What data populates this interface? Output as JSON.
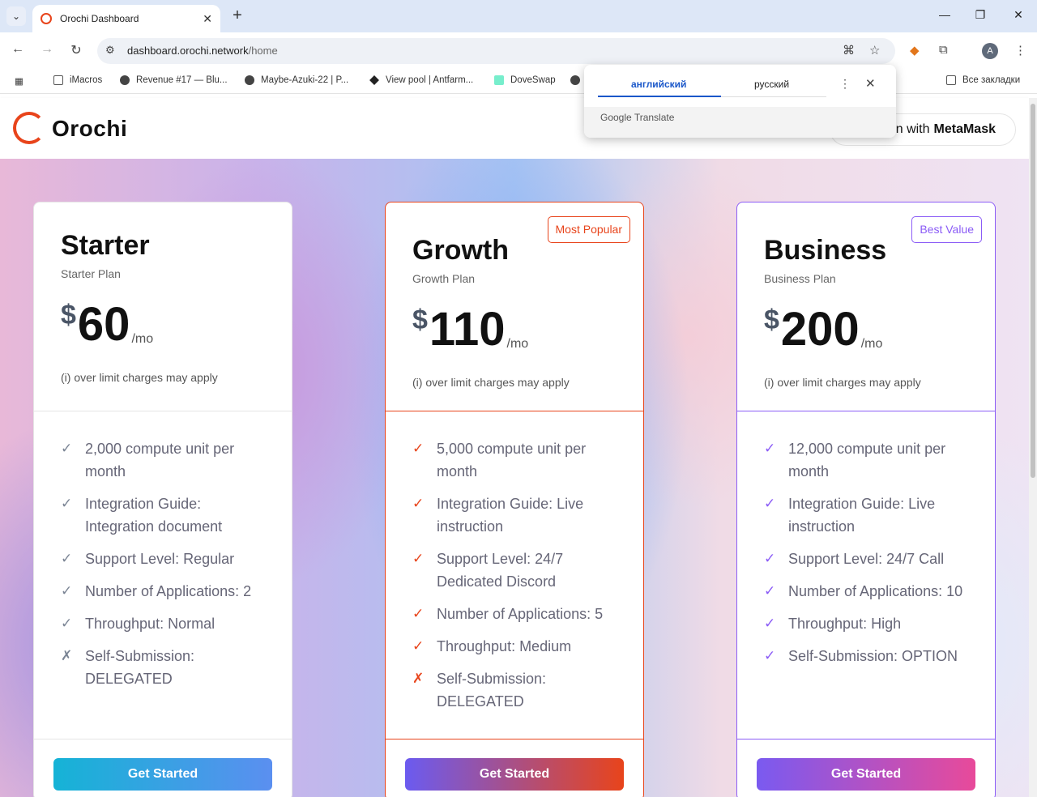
{
  "browser": {
    "tab_title": "Orochi Dashboard",
    "url_host": "dashboard.orochi.network",
    "url_path": "/home",
    "bookmarks": [
      {
        "label": "iMacros",
        "icon": "folder-icon"
      },
      {
        "label": "Revenue #17 — Blu...",
        "icon": "site-icon"
      },
      {
        "label": "Maybe-Azuki-22 | P...",
        "icon": "site-icon"
      },
      {
        "label": "View pool | Antfarm...",
        "icon": "site-icon"
      },
      {
        "label": "DoveSwap",
        "icon": "chart-icon"
      }
    ],
    "all_bookmarks": "Все закладки",
    "avatar_letter": "A"
  },
  "translate": {
    "source_lang": "английский",
    "target_lang": "русский",
    "brand": "Google Translate"
  },
  "header": {
    "logo": "Orochi",
    "connect_prefix": "n with",
    "connect_brand": "MetaMask"
  },
  "plans": [
    {
      "name": "Starter",
      "subtitle": "Starter Plan",
      "currency": "$",
      "price": "60",
      "period": "/mo",
      "note": "(i) over limit charges may apply",
      "badge": "",
      "features": [
        {
          "mark": "✓",
          "text": "2,000 compute unit per month"
        },
        {
          "mark": "✓",
          "text": "Integration Guide: Integration document"
        },
        {
          "mark": "✓",
          "text": "Support Level: Regular"
        },
        {
          "mark": "✓",
          "text": "Number of Applications: 2"
        },
        {
          "mark": "✓",
          "text": "Throughput: Normal"
        },
        {
          "mark": "✗",
          "text": "Self-Submission: DELEGATED"
        }
      ],
      "cta": "Get Started"
    },
    {
      "name": "Growth",
      "subtitle": "Growth Plan",
      "currency": "$",
      "price": "110",
      "period": "/mo",
      "note": "(i) over limit charges may apply",
      "badge": "Most Popular",
      "features": [
        {
          "mark": "✓",
          "text": "5,000 compute unit per month"
        },
        {
          "mark": "✓",
          "text": "Integration Guide: Live instruction"
        },
        {
          "mark": "✓",
          "text": "Support Level: 24/7 Dedicated Discord"
        },
        {
          "mark": "✓",
          "text": "Number of Applications: 5"
        },
        {
          "mark": "✓",
          "text": "Throughput: Medium"
        },
        {
          "mark": "✗",
          "text": "Self-Submission: DELEGATED"
        }
      ],
      "cta": "Get Started"
    },
    {
      "name": "Business",
      "subtitle": "Business Plan",
      "currency": "$",
      "price": "200",
      "period": "/mo",
      "note": "(i) over limit charges may apply",
      "badge": "Best Value",
      "features": [
        {
          "mark": "✓",
          "text": "12,000 compute unit per month"
        },
        {
          "mark": "✓",
          "text": "Integration Guide: Live instruction"
        },
        {
          "mark": "✓",
          "text": "Support Level: 24/7 Call"
        },
        {
          "mark": "✓",
          "text": "Number of Applications: 10"
        },
        {
          "mark": "✓",
          "text": "Throughput: High"
        },
        {
          "mark": "✓",
          "text": "Self-Submission: OPTION"
        }
      ],
      "cta": "Get Started"
    }
  ]
}
